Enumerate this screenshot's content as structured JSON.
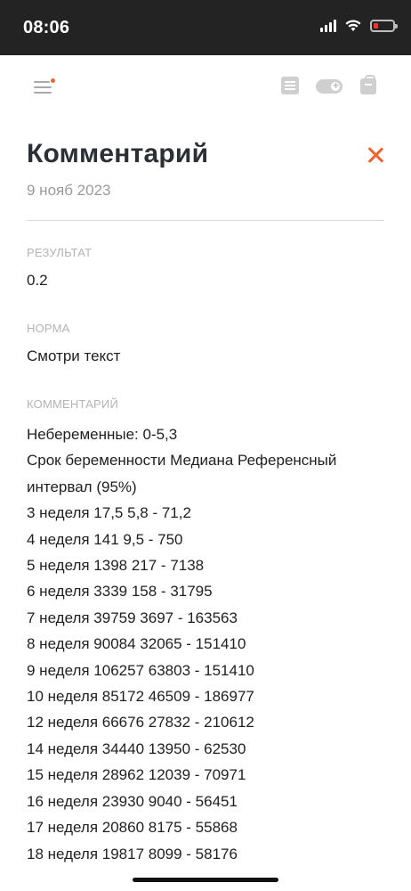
{
  "status_bar": {
    "time": "08:06",
    "accent_battery_low": "#e53935"
  },
  "toolbar": {
    "menu_icon": "hamburger-menu-icon",
    "notification_dot_color": "#f0642c",
    "icons": [
      "list-icon",
      "toggle-add-icon",
      "bag-icon"
    ]
  },
  "header": {
    "title": "Комментарий",
    "date": "9 нояб 2023",
    "close_icon": "close-icon",
    "accent_color": "#f0642c"
  },
  "result": {
    "label": "РЕЗУЛЬТАТ",
    "value": "0.2"
  },
  "norm": {
    "label": "НОРМА",
    "value": "Смотри текст"
  },
  "comment": {
    "label": "КОММЕНТАРИЙ",
    "lines": [
      "Небеременные: 0-5,3",
      "Срок беременности Медиана Референсный",
      "интервал (95%)",
      "3 неделя 17,5 5,8 - 71,2",
      "4 неделя 141 9,5 - 750",
      "5 неделя 1398 217 - 7138",
      "6 неделя 3339 158 - 31795",
      "7 неделя 39759 3697 - 163563",
      "8 неделя 90084 32065 - 151410",
      "9 неделя 106257 63803 - 151410",
      "10 неделя 85172 46509 - 186977",
      "12 неделя 66676 27832 - 210612",
      "14 неделя 34440 13950 - 62530",
      "15 неделя 28962 12039 - 70971",
      "16 неделя 23930 9040 - 56451",
      "17 неделя 20860 8175 - 55868",
      "18 неделя 19817 8099 - 58176"
    ]
  }
}
